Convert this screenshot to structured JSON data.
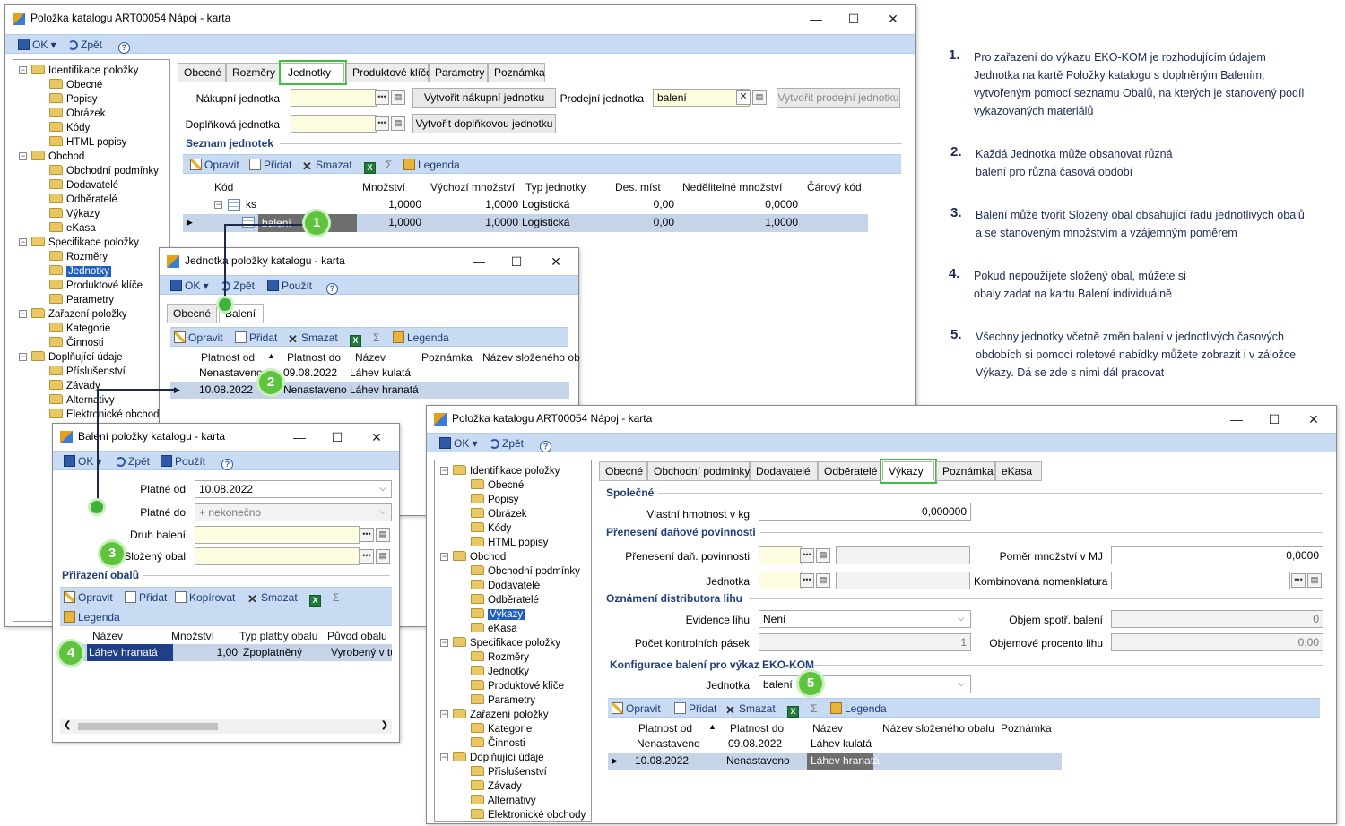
{
  "win1": {
    "title": "Položka katalogu ART00054 Nápoj - karta",
    "toolbar": {
      "ok": "OK",
      "back": "Zpět"
    },
    "tree": [
      "Identifikace položky",
      "Obecné",
      "Popisy",
      "Obrázek",
      "Kódy",
      "HTML popisy",
      "Obchod",
      "Obchodní podmínky",
      "Dodavatelé",
      "Odběratelé",
      "Výkazy",
      "eKasa",
      "Specifikace položky",
      "Rozměry",
      "Jednotky",
      "Produktové klíče",
      "Parametry",
      "Zařazení položky",
      "Kategorie",
      "Činnosti",
      "Doplňující údaje",
      "Příslušenství",
      "Závady",
      "Alternativy",
      "Elektronické obchody"
    ],
    "tabs": [
      "Obecné",
      "Rozměry",
      "Jednotky",
      "Produktové klíče",
      "Parametry",
      "Poznámka"
    ],
    "nakupni_label": "Nákupní jednotka",
    "btn_nakupni": "Vytvořit nákupní jednotku",
    "prodejni_label": "Prodejní jednotka",
    "prodejni_value": "balení",
    "btn_prodejni": "Vytvořit prodejní jednotku",
    "doplnkova_label": "Doplňková jednotka",
    "btn_doplnkova": "Vytvořit doplňkovou jednotku",
    "section": "Seznam jednotek",
    "grid_toolbar": {
      "edit": "Opravit",
      "add": "Přidat",
      "del": "Smazat",
      "legend": "Legenda"
    },
    "columns": [
      "Kód",
      "Množství",
      "Výchozí množství",
      "Typ jednotky",
      "Des. míst",
      "Nedělitelné množství",
      "Čárový kód"
    ],
    "rows": [
      [
        "ks",
        "1,0000",
        "1,0000",
        "Logistická",
        "0,00",
        "0,0000",
        ""
      ],
      [
        "balení",
        "1,0000",
        "1,0000",
        "Logistická",
        "0,00",
        "1,0000",
        ""
      ]
    ]
  },
  "win2": {
    "title": "Jednotka položky katalogu - karta",
    "toolbar": {
      "ok": "OK",
      "back": "Zpět",
      "use": "Použít"
    },
    "tabs": [
      "Obecné",
      "Balení"
    ],
    "grid_toolbar": {
      "edit": "Opravit",
      "add": "Přidat",
      "del": "Smazat",
      "legend": "Legenda"
    },
    "columns": [
      "Platnost od",
      "Platnost do",
      "Název",
      "Poznámka",
      "Název složeného ob"
    ],
    "rows": [
      [
        "Nenastaveno",
        "09.08.2022",
        "Láhev kulatá",
        "",
        ""
      ],
      [
        "10.08.2022",
        "Nenastaveno",
        "Láhev hranatá",
        "",
        ""
      ]
    ]
  },
  "win3": {
    "title": "Balení položky katalogu - karta",
    "toolbar": {
      "ok": "OK",
      "back": "Zpět",
      "use": "Použít"
    },
    "platne_od_label": "Platné od",
    "platne_od": "10.08.2022",
    "platne_do_label": "Platné do",
    "platne_do": "+ nekonečno",
    "druh_label": "Druh balení",
    "slozeny_label": "Složený obal",
    "section": "Přiřazení obalů",
    "grid_toolbar": {
      "edit": "Opravit",
      "add": "Přidat",
      "copy": "Kopírovat",
      "del": "Smazat",
      "legend": "Legenda"
    },
    "columns": [
      "Název",
      "Množství",
      "Typ platby obalu",
      "Původ obalu"
    ],
    "rows": [
      [
        "Láhev hranatá",
        "1,00",
        "Zpoplatněný",
        "Vyrobený v tuze"
      ]
    ]
  },
  "win4": {
    "title": "Položka katalogu ART00054 Nápoj - karta",
    "toolbar": {
      "ok": "OK",
      "back": "Zpět"
    },
    "tree": [
      "Identifikace položky",
      "Obecné",
      "Popisy",
      "Obrázek",
      "Kódy",
      "HTML popisy",
      "Obchod",
      "Obchodní podmínky",
      "Dodavatelé",
      "Odběratelé",
      "Výkazy",
      "eKasa",
      "Specifikace položky",
      "Rozměry",
      "Jednotky",
      "Produktové klíče",
      "Parametry",
      "Zařazení položky",
      "Kategorie",
      "Činnosti",
      "Doplňující údaje",
      "Příslušenství",
      "Závady",
      "Alternativy",
      "Elektronické obchody"
    ],
    "tabs": [
      "Obecné",
      "Obchodní podmínky",
      "Dodavatelé",
      "Odběratelé",
      "Výkazy",
      "Poznámka",
      "eKasa"
    ],
    "sec_spolecne": "Společné",
    "hmotnost_label": "Vlastní hmotnost v kg",
    "hmotnost": "0,000000",
    "sec_preneseni": "Přenesení daňové povinnosti",
    "preneseni_label": "Přenesení daň. povinnosti",
    "pomer_label": "Poměr množství v MJ",
    "pomer": "0,0000",
    "jednotka_label": "Jednotka",
    "kombinovana_label": "Kombinovaná nomenklatura",
    "sec_lih": "Oznámení distributora lihu",
    "evidence_label": "Evidence lihu",
    "evidence": "Není",
    "objem_label": "Objem spotř. balení",
    "objem": "0",
    "pasky_label": "Počet kontrolních pásek",
    "pasky": "1",
    "procento_label": "Objemové procento lihu",
    "procento": "0,00",
    "sec_ekokom": "Konfigurace balení pro výkaz EKO-KOM",
    "ek_jednotka_label": "Jednotka",
    "ek_jednotka": "balení",
    "grid_toolbar": {
      "edit": "Opravit",
      "add": "Přidat",
      "del": "Smazat",
      "legend": "Legenda"
    },
    "columns": [
      "Platnost od",
      "Platnost do",
      "Název",
      "Název složeného obalu",
      "Poznámka"
    ],
    "rows": [
      [
        "Nenastaveno",
        "09.08.2022",
        "Láhev kulatá",
        "",
        ""
      ],
      [
        "10.08.2022",
        "Nenastaveno",
        "Láhev hranatá",
        "",
        ""
      ]
    ]
  },
  "badges": [
    "1",
    "2",
    "3",
    "4",
    "5"
  ],
  "notes": [
    {
      "num": "1.",
      "text": "Pro zařazení do výkazu EKO-KOM je rozhodujícím údajem Jednotka na kartě Položky katalogu s doplněným Balením, vytvořeným pomocí seznamu Obalů, na kterých je stanovený podíl vykazovaných materiálů"
    },
    {
      "num": "2.",
      "text": "Každá Jednotka může obsahovat různá balení pro různá časová období"
    },
    {
      "num": "3.",
      "text": "Balení může tvořit Složený obal obsahující řadu jednotlivých obalů a se stanoveným množstvím a vzájemným poměrem"
    },
    {
      "num": "4.",
      "text": "Pokud nepoužíjete složený obal, můžete si obaly zadat na kartu Balení individuálně"
    },
    {
      "num": "5.",
      "text": "Všechny jednotky včetně změn balení v jednotlivých časových obdobích si pomocí roletové nabídky můžete zobrazit i v záložce Výkazy.  Dá se zde s nimi dál pracovat"
    }
  ]
}
